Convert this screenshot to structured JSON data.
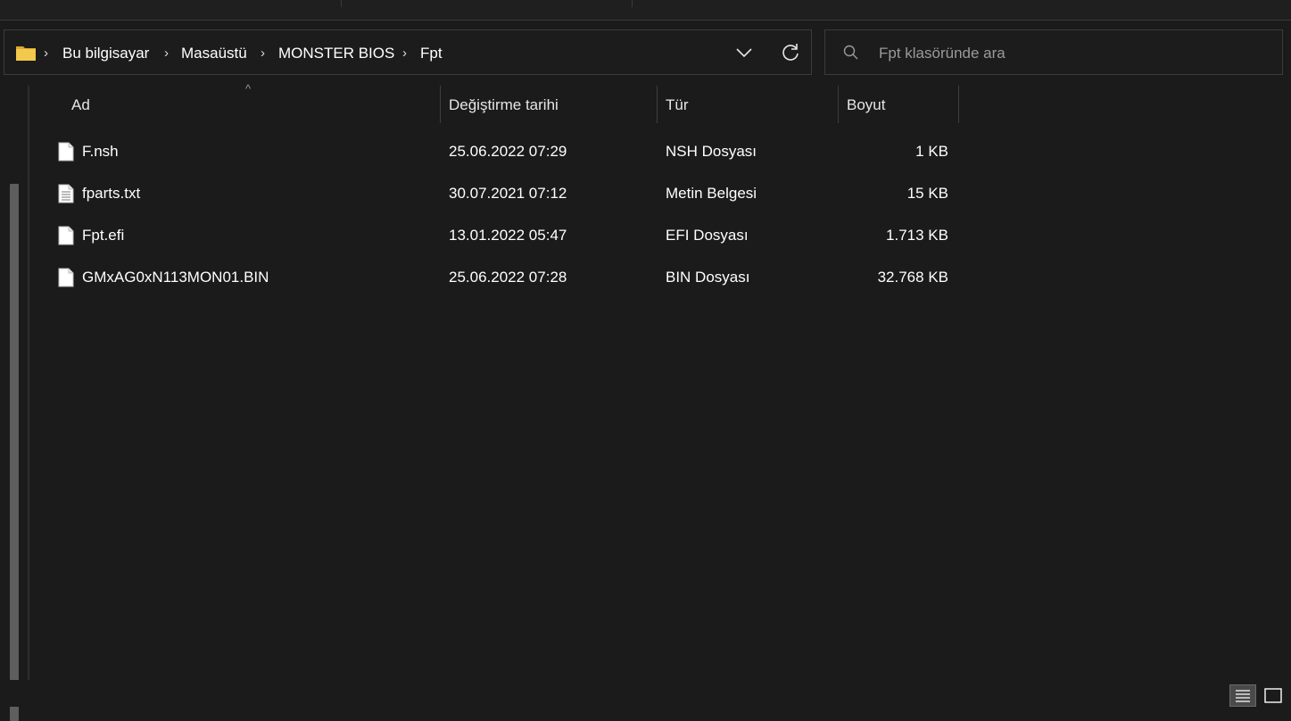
{
  "breadcrumb": {
    "items": [
      "Bu bilgisayar",
      "Masaüstü",
      "MONSTER BIOS",
      "Fpt"
    ]
  },
  "search": {
    "placeholder": "Fpt klasöründe ara"
  },
  "columns": {
    "name": "Ad",
    "modified": "Değiştirme tarihi",
    "type": "Tür",
    "size": "Boyut"
  },
  "files": [
    {
      "name": "F.nsh",
      "modified": "25.06.2022 07:29",
      "type": "NSH Dosyası",
      "size": "1 KB",
      "icon": "file-icon"
    },
    {
      "name": "fparts.txt",
      "modified": "30.07.2021 07:12",
      "type": "Metin Belgesi",
      "size": "15 KB",
      "icon": "text-file-icon"
    },
    {
      "name": "Fpt.efi",
      "modified": "13.01.2022 05:47",
      "type": "EFI Dosyası",
      "size": "1.713 KB",
      "icon": "file-icon"
    },
    {
      "name": "GMxAG0xN113MON01.BIN",
      "modified": "25.06.2022 07:28",
      "type": "BIN Dosyası",
      "size": "32.768 KB",
      "icon": "file-icon"
    }
  ],
  "icons": {
    "address": "folder-icon",
    "dropdown": "chevron-down-icon",
    "refresh": "refresh-icon",
    "search": "search-icon",
    "views": [
      "details-view-icon",
      "tiles-view-icon"
    ]
  },
  "colors": {
    "background": "#1b1b1b",
    "folder": "#f2c94c",
    "text": "#ffffff",
    "border": "#3b3b3b"
  }
}
